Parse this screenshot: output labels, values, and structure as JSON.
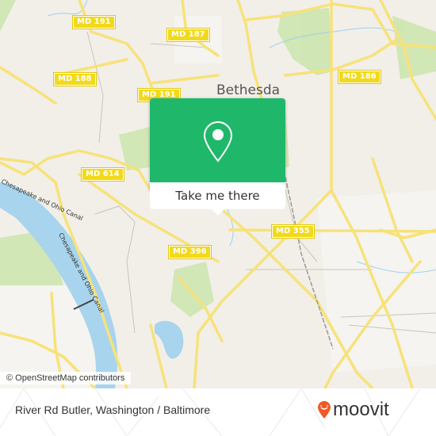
{
  "map": {
    "place_label": "Bethesda",
    "route_shields": [
      {
        "id": "md191-top",
        "label": "MD 191"
      },
      {
        "id": "md187",
        "label": "MD 187"
      },
      {
        "id": "md188",
        "label": "MD 188"
      },
      {
        "id": "md191-mid",
        "label": "MD 191"
      },
      {
        "id": "md186",
        "label": "MD 186"
      },
      {
        "id": "md614",
        "label": "MD 614"
      },
      {
        "id": "md355",
        "label": "MD 355"
      },
      {
        "id": "md396",
        "label": "MD 396"
      }
    ],
    "waterway_labels": [
      "Chesapeake and Ohio Canal",
      "Chesapeake and Ohio Canal"
    ],
    "attribution": "© OpenStreetMap contributors"
  },
  "popup": {
    "icon": "map-pin-icon",
    "button_label": "Take me there",
    "color": "#1fb86a"
  },
  "footer": {
    "title": "River Rd Butler, Washington / Baltimore",
    "logo_text": "moovit",
    "logo_color": "#f05a28"
  }
}
